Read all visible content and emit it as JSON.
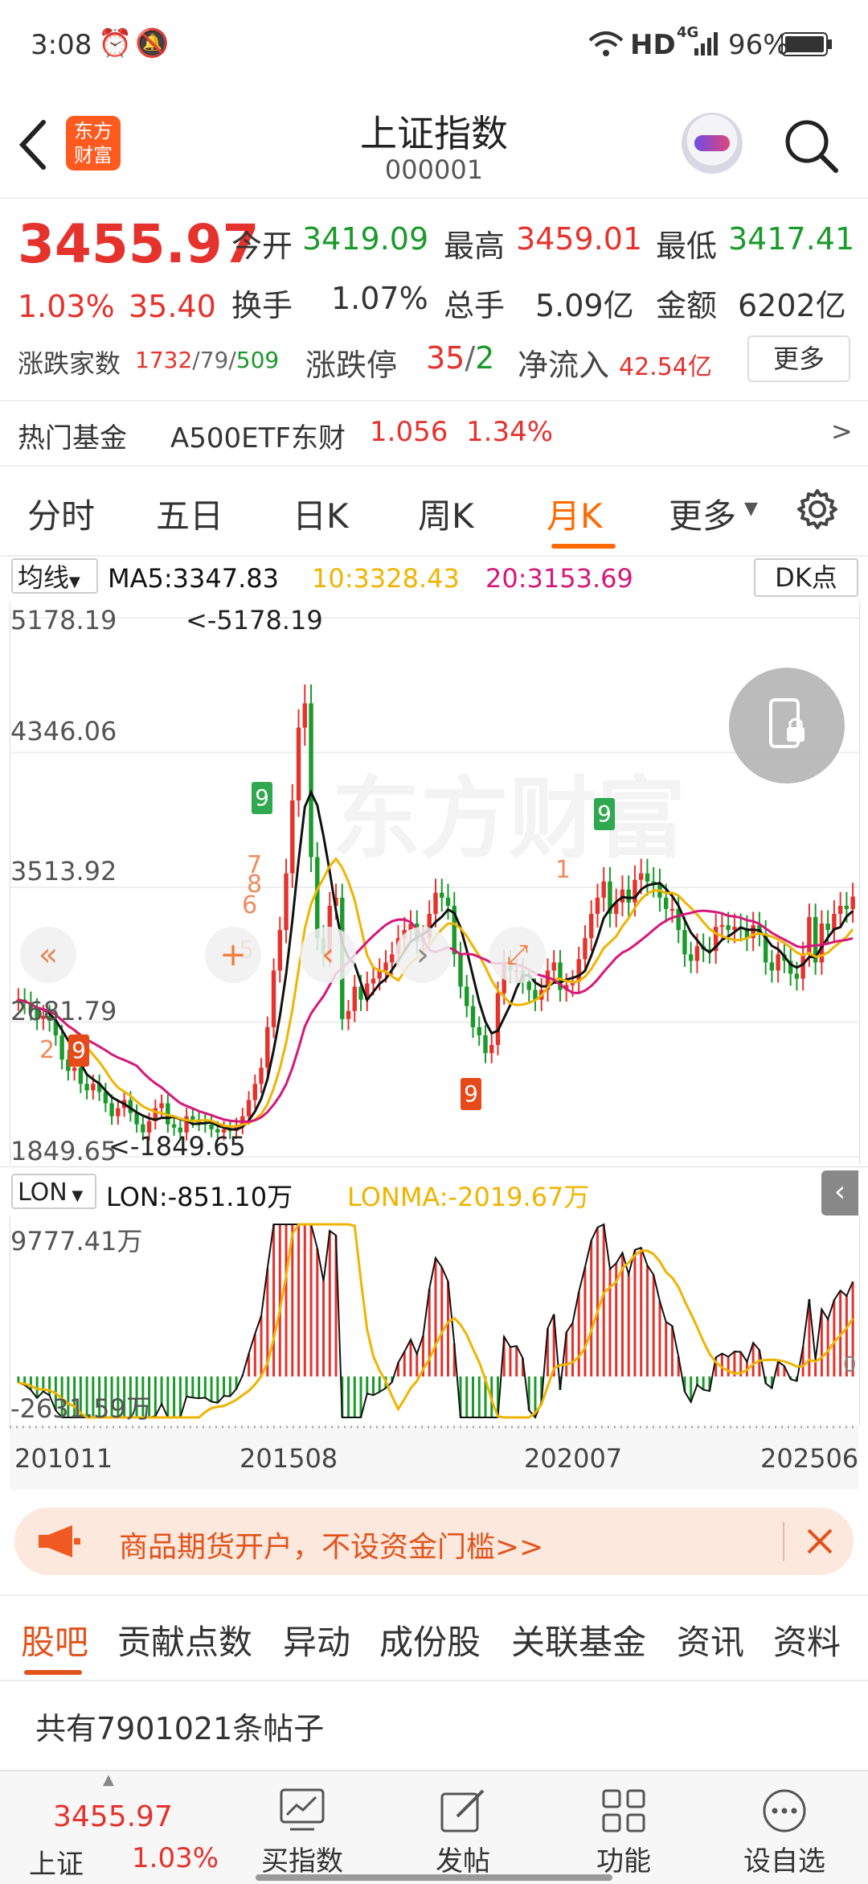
{
  "status": {
    "time": "3:08",
    "network": "HD",
    "signal": "4G",
    "battery": "96%"
  },
  "header": {
    "title": "上证指数",
    "code": "000001",
    "logo_text": "东方财富"
  },
  "quote": {
    "price": "3455.97",
    "change_pct": "1.03%",
    "change": "35.40",
    "open_label": "今开",
    "open": "3419.09",
    "high_label": "最高",
    "high": "3459.01",
    "low_label": "最低",
    "low": "3417.41",
    "turnover_label": "换手",
    "turnover": "1.07%",
    "volume_label": "总手",
    "volume": "5.09亿",
    "amount_label": "金额",
    "amount": "6202亿",
    "breadth_label": "涨跌家数",
    "breadth_up": "1732",
    "breadth_flat": "79",
    "breadth_down": "509",
    "limit_label": "涨跌停",
    "limit_up": "35",
    "limit_down": "2",
    "inflow_label": "净流入",
    "inflow": "42.54亿",
    "more": "更多"
  },
  "hot_fund": {
    "label": "热门基金",
    "name": "A500ETF东财",
    "price": "1.056",
    "pct": "1.34%",
    "arrow": ">"
  },
  "tabs": [
    "分时",
    "五日",
    "日K",
    "周K",
    "月K",
    "更多"
  ],
  "active_tab": "月K",
  "ma": {
    "selector": "均线",
    "ma5": "MA5:3347.83",
    "ma10": "10:3328.43",
    "ma20": "20:3153.69",
    "dk": "DK点"
  },
  "chart_labels": {
    "y1": "5178.19",
    "y2": "4346.06",
    "y3": "3513.92",
    "y4": "2681.79",
    "y5": "1849.65",
    "max_mark": "<-5178.19",
    "min_mark": "<-1849.65",
    "watermark": "东方财富"
  },
  "signals": {
    "nine_a": "9",
    "nine_b": "9",
    "nine_c": "9",
    "nine_d": "9",
    "s7": "7",
    "s8": "8",
    "s6": "6",
    "s5": "5",
    "s1": "1",
    "s2": "2"
  },
  "lon": {
    "selector": "LON",
    "value": "LON:-851.10万",
    "lonma": "LONMA:-2019.67万",
    "y_top": "9777.41万",
    "y_bottom": "-2631.59万",
    "zero": "0"
  },
  "dates": [
    "201011",
    "201508",
    "202007",
    "202506"
  ],
  "ad": {
    "text": "商品期货开户，不设资金门槛>>"
  },
  "sub_tabs": [
    "股吧",
    "贡献点数",
    "异动",
    "成份股",
    "关联基金",
    "资讯",
    "资料"
  ],
  "posts": {
    "text": "共有7901021条帖子"
  },
  "bottom": {
    "price": "3455.97",
    "name": "上证",
    "pct": "1.03%",
    "items": [
      "买指数",
      "发帖",
      "功能",
      "设自选"
    ]
  },
  "colors": {
    "up": "#e5322d",
    "down": "#1a9a2a",
    "accent": "#ff6a00",
    "ma5": "#111111",
    "ma10": "#f0b400",
    "ma20": "#d6177a"
  },
  "chart_data": {
    "type": "candlestick",
    "title": "",
    "period": "monthly",
    "x_ticks": [
      "201011",
      "201508",
      "202007",
      "202506"
    ],
    "ylim": [
      1849.65,
      5178.19
    ],
    "y_ticks": [
      5178.19,
      4346.06,
      3513.92,
      2681.79,
      1849.65
    ],
    "max": 5178.19,
    "min": 1849.65,
    "ma_lines": [
      {
        "name": "MA5",
        "last": 3347.83
      },
      {
        "name": "10",
        "last": 3328.43
      },
      {
        "name": "20",
        "last": 3153.69
      }
    ],
    "close_series": [
      2820,
      2800,
      2760,
      2700,
      2720,
      2690,
      2600,
      2450,
      2380,
      2400,
      2300,
      2260,
      2300,
      2250,
      2180,
      2100,
      2150,
      2200,
      2120,
      2050,
      2000,
      2070,
      2150,
      2180,
      2050,
      2030,
      2000,
      2100,
      2080,
      2060,
      2050,
      2020,
      2000,
      2020,
      2010,
      2040,
      2100,
      2200,
      2300,
      2400,
      2650,
      3000,
      3250,
      3600,
      4050,
      4500,
      4650,
      3700,
      3200,
      3100,
      3400,
      3450,
      2700,
      2750,
      2900,
      2820,
      2920,
      2950,
      3000,
      3050,
      3100,
      3200,
      3250,
      3290,
      3180,
      3200,
      3350,
      3480,
      3450,
      3400,
      3100,
      2900,
      2780,
      2650,
      2600,
      2490,
      2540,
      2860,
      3050,
      3000,
      3000,
      2930,
      2880,
      2820,
      2880,
      3000,
      3050,
      2880,
      2910,
      2930,
      3070,
      3200,
      3350,
      3450,
      3550,
      3350,
      3420,
      3500,
      3420,
      3560,
      3600,
      3550,
      3540,
      3450,
      3380,
      3380,
      3250,
      3100,
      3060,
      3150,
      3130,
      3120,
      3270,
      3280,
      3250,
      3270,
      3260,
      3200,
      3280,
      3230,
      3050,
      3000,
      3100,
      3060,
      2980,
      2950,
      3100,
      3330,
      3050,
      3290,
      3250,
      3350,
      3400,
      3380,
      3456
    ],
    "lon_ylim": [
      -2631.59,
      9777.41
    ],
    "lon_last": -851.1,
    "lonma_last": -2019.67
  }
}
